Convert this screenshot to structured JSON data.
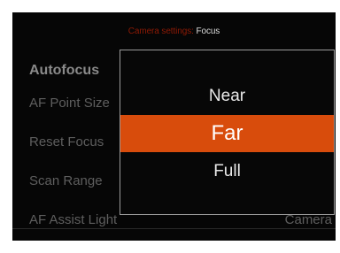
{
  "header": {
    "section": "Camera settings",
    "separator": ":",
    "page": "Focus"
  },
  "menu": {
    "title": "Autofocus",
    "items": [
      {
        "label": "AF Point Size"
      },
      {
        "label": "Reset Focus"
      },
      {
        "label": "Scan Range"
      },
      {
        "label": "AF Assist Light",
        "value": "Camera"
      }
    ]
  },
  "popup": {
    "options": [
      {
        "label": "Near",
        "selected": false
      },
      {
        "label": "Far",
        "selected": true
      },
      {
        "label": "Full",
        "selected": false
      }
    ]
  },
  "colors": {
    "accent": "#d84c0c",
    "header_section": "#8f1a05",
    "background": "#060606"
  }
}
